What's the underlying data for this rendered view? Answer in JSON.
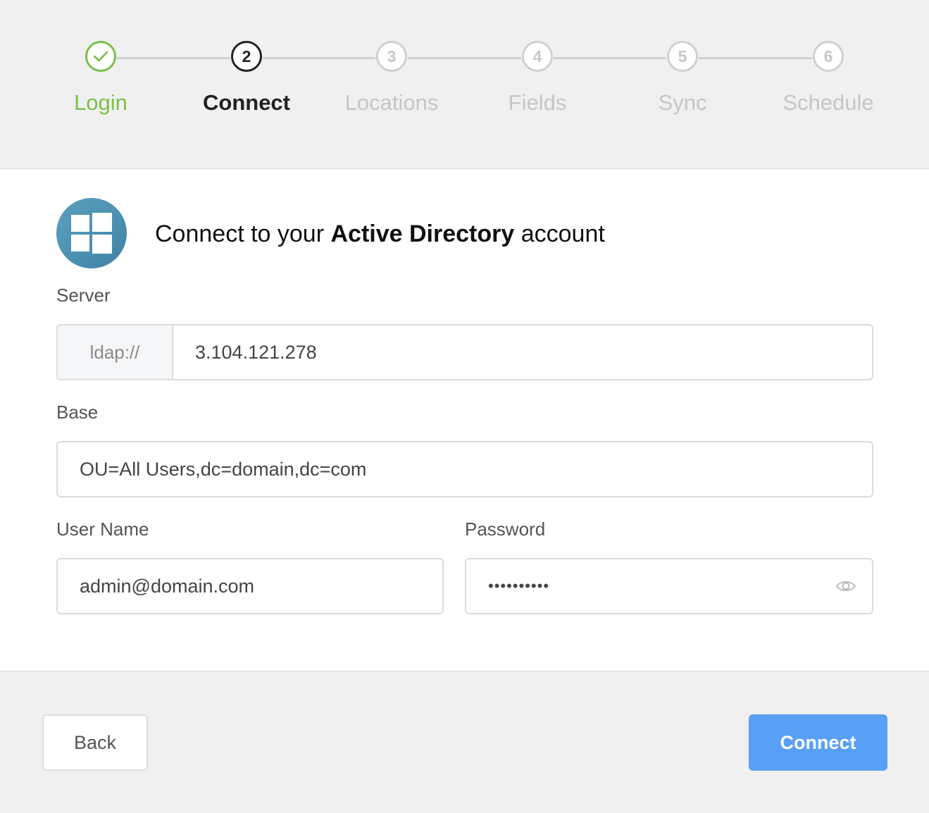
{
  "stepper": {
    "steps": [
      {
        "number": "",
        "label": "Login",
        "state": "done"
      },
      {
        "number": "2",
        "label": "Connect",
        "state": "active"
      },
      {
        "number": "3",
        "label": "Locations",
        "state": "pending"
      },
      {
        "number": "4",
        "label": "Fields",
        "state": "pending"
      },
      {
        "number": "5",
        "label": "Sync",
        "state": "pending"
      },
      {
        "number": "6",
        "label": "Schedule",
        "state": "pending"
      }
    ]
  },
  "header": {
    "prefix": "Connect to your ",
    "bold": "Active Directory",
    "suffix": " account",
    "logo_icon": "windows-logo-icon"
  },
  "form": {
    "server": {
      "label": "Server",
      "prefix": "ldap://",
      "value": "3.104.121.278"
    },
    "base": {
      "label": "Base",
      "value": "OU=All Users,dc=domain,dc=com"
    },
    "username": {
      "label": "User Name",
      "value": "admin@domain.com"
    },
    "password": {
      "label": "Password",
      "masked_value": "••••••••••",
      "toggle_icon": "eye-icon"
    }
  },
  "footer": {
    "back_label": "Back",
    "connect_label": "Connect"
  },
  "colors": {
    "done": "#7bbf45",
    "active": "#222222",
    "pending": "#c4c6cb",
    "primary_button": "#58a0f5",
    "logo": "#4b8fb0"
  }
}
